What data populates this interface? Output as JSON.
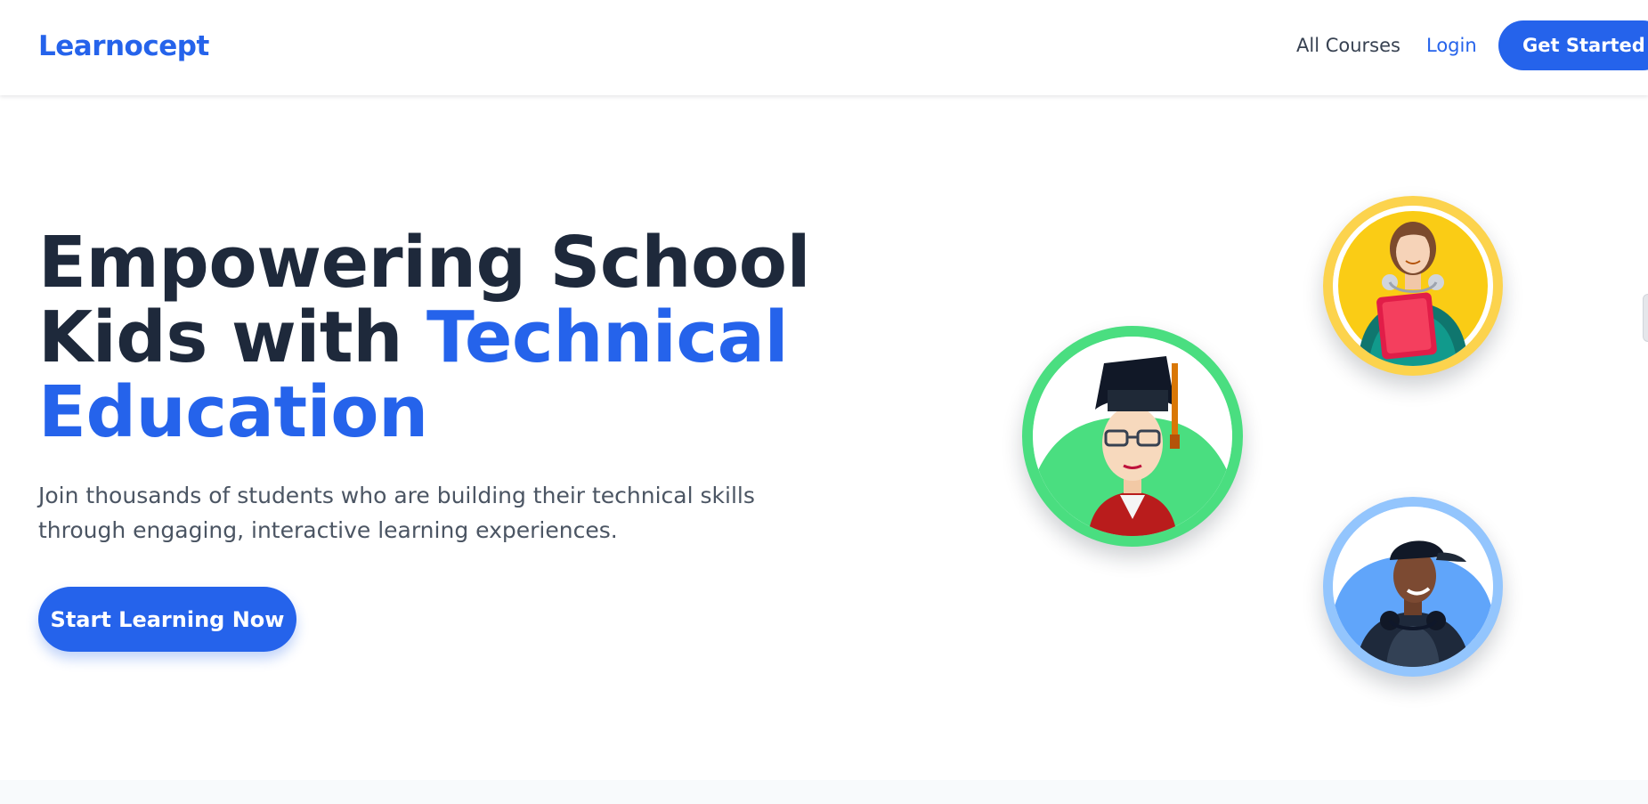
{
  "header": {
    "logo_text": "Learnocept",
    "nav": {
      "all_courses": "All Courses",
      "login": "Login",
      "get_started": "Get Started"
    }
  },
  "hero": {
    "title_line1": "Empowering School",
    "title_line2_plain": "Kids with ",
    "title_line2_accent": "Technical",
    "title_line3_accent": "Education",
    "subtitle": "Join thousands of students who are building their technical skills through engaging, interactive learning experiences.",
    "cta_label": "Start Learning Now"
  },
  "avatars": [
    {
      "description": "student-with-notebook",
      "ring_color": "#fcd34d",
      "fill_color": "#facc15"
    },
    {
      "description": "graduate-student",
      "ring_color": "#4ade80",
      "fill_color": "#4ade80"
    },
    {
      "description": "smiling-student-with-cap",
      "ring_color": "#93c5fd",
      "fill_color": "#60a5fa"
    }
  ],
  "colors": {
    "brand": "#2563eb",
    "heading": "#1e293b",
    "body_text": "#4b5563",
    "nav_text": "#374151"
  }
}
